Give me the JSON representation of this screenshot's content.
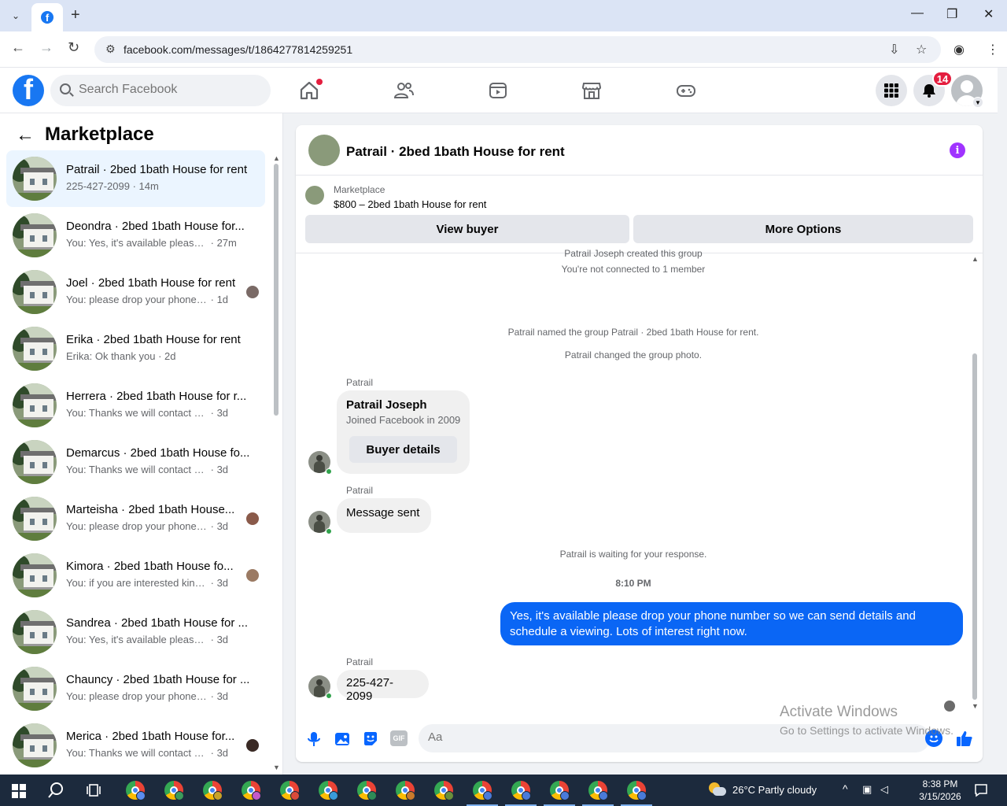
{
  "browser": {
    "url": "facebook.com/messages/t/1864277814259251",
    "new_tab": "+",
    "minimize": "—",
    "maximize": "❐",
    "close": "✕"
  },
  "header": {
    "search_placeholder": "Search Facebook",
    "notification_count": "14"
  },
  "left_panel": {
    "title": "Marketplace",
    "conversations": [
      {
        "name": "Patrail · 2bed 1bath House for rent",
        "snippet": "225-427-2099",
        "time": "14m",
        "active": true
      },
      {
        "name": "Deondra · 2bed 1bath House for...",
        "snippet": "You: Yes, it's available please drop...",
        "time": "27m"
      },
      {
        "name": "Joel · 2bed 1bath House for rent",
        "snippet": "You: please drop your phone nu...",
        "time": "1d"
      },
      {
        "name": "Erika · 2bed 1bath House for rent",
        "snippet": "Erika: Ok thank you",
        "time": "2d"
      },
      {
        "name": "Herrera · 2bed 1bath House for r...",
        "snippet": "You: Thanks we will contact you so...",
        "time": "3d"
      },
      {
        "name": "Demarcus · 2bed 1bath House fo...",
        "snippet": "You: Thanks we will contact you so...",
        "time": "3d"
      },
      {
        "name": "Marteisha · 2bed 1bath House...",
        "snippet": "You: please drop your phone nu...",
        "time": "3d"
      },
      {
        "name": "Kimora · 2bed 1bath House fo...",
        "snippet": "You: if you are interested kindly ...",
        "time": "3d"
      },
      {
        "name": "Sandrea · 2bed 1bath House for ...",
        "snippet": "You: Yes, it's available please drop y...",
        "time": "3d"
      },
      {
        "name": "Chauncy · 2bed 1bath House for ...",
        "snippet": "You: please drop your phone numb...",
        "time": "3d"
      },
      {
        "name": "Merica · 2bed 1bath House for...",
        "snippet": "You: Thanks we will contact you ...",
        "time": "3d"
      }
    ]
  },
  "chat": {
    "title": "Patrail · 2bed 1bath House for rent",
    "marketplace_label": "Marketplace",
    "listing": "$800 – 2bed 1bath House for rent",
    "view_buyer": "View buyer",
    "more_options": "More Options",
    "sys_created": "Patrail Joseph created this group",
    "sys_not_connected": "You're not connected to 1 member",
    "sys_named": "Patrail named the group Patrail · 2bed 1bath House for rent.",
    "sys_photo": "Patrail changed the group photo.",
    "sender": "Patrail",
    "card_name": "Patrail Joseph",
    "card_joined": "Joined Facebook in 2009",
    "card_button": "Buyer details",
    "msg_sent": "Message sent",
    "sys_waiting": "Patrail is waiting for your response.",
    "time_label": "8:10 PM",
    "outgoing": "Yes, it's available please drop your phone number so we can send details and schedule a viewing. Lots of interest right now.",
    "phone_msg": "225-427-2099",
    "composer_placeholder": "Aa",
    "gif_label": "GIF"
  },
  "watermark": {
    "line1": "Activate Windows",
    "line2": "Go to Settings to activate Windows."
  },
  "taskbar": {
    "weather": "26°C  Partly cloudy",
    "time": "8:38 PM",
    "date": "3/15/2026"
  }
}
